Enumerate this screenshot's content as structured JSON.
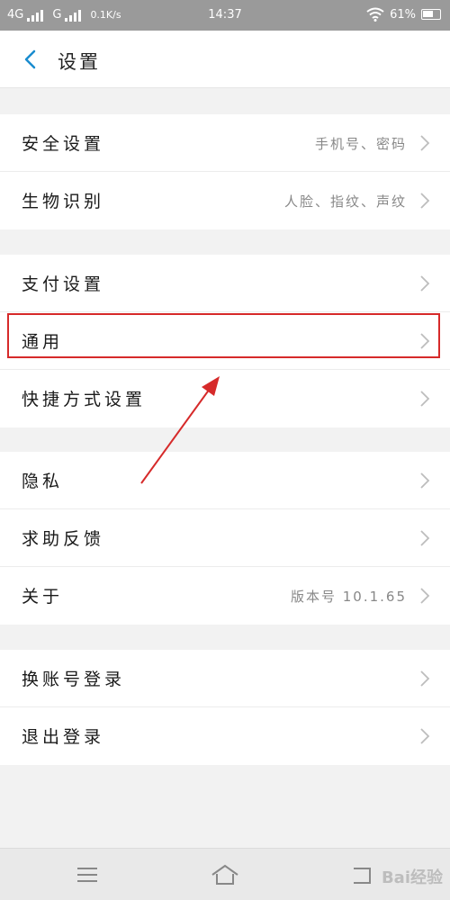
{
  "status_bar": {
    "network1": "4G",
    "network2": "G",
    "speed": "0.1K/s",
    "time": "14:37",
    "battery": "61%"
  },
  "header": {
    "title": "设置"
  },
  "groups": [
    [
      {
        "label": "安全设置",
        "value": "手机号、密码"
      },
      {
        "label": "生物识别",
        "value": "人脸、指纹、声纹"
      }
    ],
    [
      {
        "label": "支付设置",
        "value": ""
      },
      {
        "label": "通用",
        "value": ""
      },
      {
        "label": "快捷方式设置",
        "value": ""
      }
    ],
    [
      {
        "label": "隐私",
        "value": ""
      },
      {
        "label": "求助反馈",
        "value": ""
      },
      {
        "label": "关于",
        "value": "版本号 10.1.65"
      }
    ],
    [
      {
        "label": "换账号登录",
        "value": ""
      },
      {
        "label": "退出登录",
        "value": ""
      }
    ]
  ],
  "icons": {
    "back": "chevron-left-icon",
    "row_arrow": "chevron-right-icon",
    "nav_menu": "menu-icon",
    "nav_home": "home-icon",
    "nav_back": "back-icon"
  },
  "colors": {
    "accent": "#1a8ccf",
    "highlight": "#d62a2a"
  },
  "watermark": "Bai经验"
}
